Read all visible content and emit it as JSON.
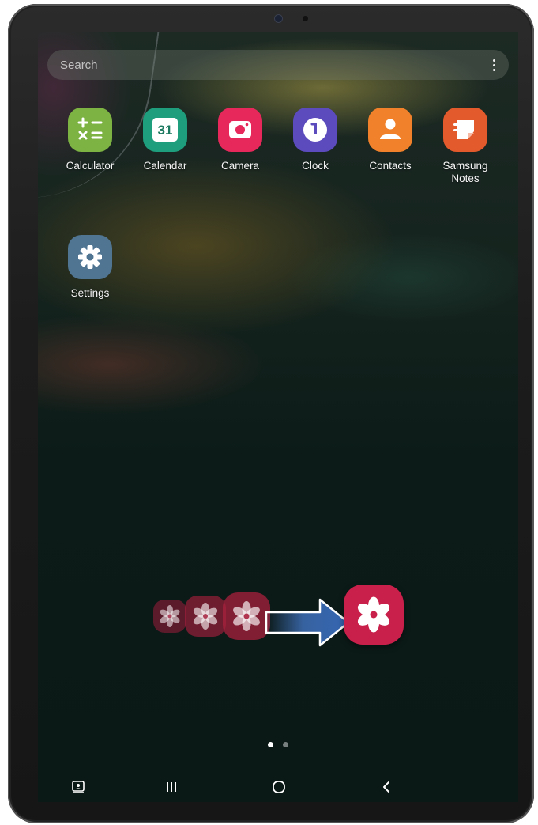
{
  "search": {
    "placeholder": "Search",
    "menu_icon": "more-vertical-icon"
  },
  "apps": [
    {
      "label": "Calculator",
      "icon": "calculator-icon",
      "color": "#7cb342"
    },
    {
      "label": "Calendar",
      "icon": "calendar-icon",
      "color": "#1e9e7c",
      "badge": "31"
    },
    {
      "label": "Camera",
      "icon": "camera-icon",
      "color": "#e6285a"
    },
    {
      "label": "Clock",
      "icon": "clock-icon",
      "color": "#5b4bbd"
    },
    {
      "label": "Contacts",
      "icon": "contacts-icon",
      "color": "#f2812b"
    },
    {
      "label": "Samsung Notes",
      "icon": "notes-icon",
      "color": "#e35a2c"
    },
    {
      "label": "Settings",
      "icon": "settings-icon",
      "color": "#4f7593"
    }
  ],
  "illustration": {
    "icon": "flower-icon",
    "color": "#c8204a",
    "arrow_color": "#3f6fb8"
  },
  "pages": {
    "count": 2,
    "current": 1
  },
  "navbar": {
    "buttons": [
      "screenshot-icon",
      "recent-apps-icon",
      "home-icon",
      "back-icon"
    ]
  }
}
